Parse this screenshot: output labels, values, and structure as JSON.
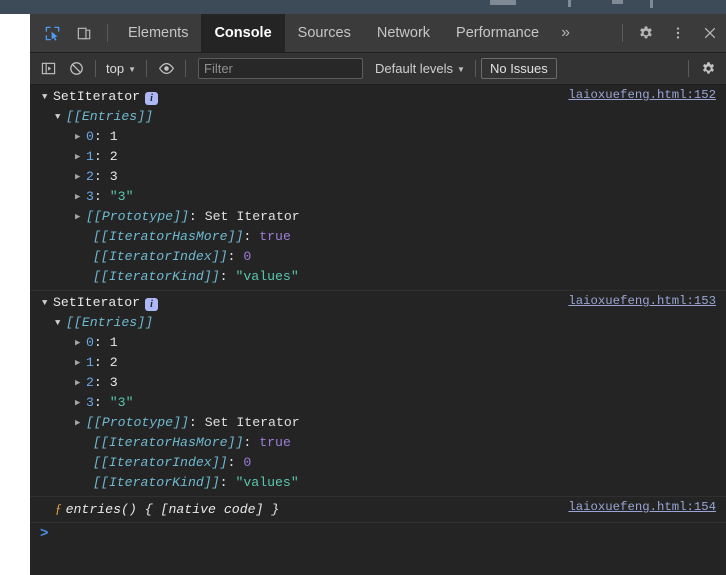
{
  "window": {
    "background_color": "#242424",
    "chrome_strip_color": "#3c4b57"
  },
  "tabbar": {
    "icons": [
      {
        "name": "inspect-element-icon",
        "glyph": "inspect",
        "active": true
      },
      {
        "name": "device-toolbar-icon",
        "glyph": "device",
        "active": false
      }
    ],
    "tabs": [
      {
        "label": "Elements",
        "selected": false
      },
      {
        "label": "Console",
        "selected": true
      },
      {
        "label": "Sources",
        "selected": false
      },
      {
        "label": "Network",
        "selected": false
      },
      {
        "label": "Performance",
        "selected": false
      }
    ],
    "more_tabs_label": "»",
    "settings_label": "gear-icon",
    "menu_label": "kebab-menu-icon",
    "close_label": "✕",
    "accent_color": "#4c9bf0"
  },
  "toolbar": {
    "sidebar_toggle": "show-console-sidebar",
    "clear_console": "clear-console",
    "context": {
      "label": "top",
      "caret": "▼"
    },
    "live_expression": "create-live-expression",
    "filter": {
      "value": "",
      "placeholder": "Filter"
    },
    "levels": {
      "label": "Default levels",
      "caret": "▼"
    },
    "issues": {
      "label": "No Issues"
    },
    "settings": "console-settings"
  },
  "console": {
    "messages": [
      {
        "type": "object",
        "header": "SetIterator",
        "badge": "i",
        "expanded": true,
        "source_link": "laioxuefeng.html:152",
        "entries_label": "[[Entries]]",
        "entries_expanded": true,
        "entries": [
          {
            "key": "0",
            "value": "1",
            "value_kind": "number"
          },
          {
            "key": "1",
            "value": "2",
            "value_kind": "number"
          },
          {
            "key": "2",
            "value": "3",
            "value_kind": "number"
          },
          {
            "key": "3",
            "value": "\"3\"",
            "value_kind": "string"
          }
        ],
        "prototype": {
          "key": "[[Prototype]]",
          "value": "Set Iterator"
        },
        "slots": [
          {
            "key": "[[IteratorHasMore]]",
            "value": "true",
            "value_kind": "boolean"
          },
          {
            "key": "[[IteratorIndex]]",
            "value": "0",
            "value_kind": "number"
          },
          {
            "key": "[[IteratorKind]]",
            "value": "\"values\"",
            "value_kind": "string"
          }
        ]
      },
      {
        "type": "object",
        "header": "SetIterator",
        "badge": "i",
        "expanded": true,
        "source_link": "laioxuefeng.html:153",
        "entries_label": "[[Entries]]",
        "entries_expanded": true,
        "entries": [
          {
            "key": "0",
            "value": "1",
            "value_kind": "number"
          },
          {
            "key": "1",
            "value": "2",
            "value_kind": "number"
          },
          {
            "key": "2",
            "value": "3",
            "value_kind": "number"
          },
          {
            "key": "3",
            "value": "\"3\"",
            "value_kind": "string"
          }
        ],
        "prototype": {
          "key": "[[Prototype]]",
          "value": "Set Iterator"
        },
        "slots": [
          {
            "key": "[[IteratorHasMore]]",
            "value": "true",
            "value_kind": "boolean"
          },
          {
            "key": "[[IteratorIndex]]",
            "value": "0",
            "value_kind": "number"
          },
          {
            "key": "[[IteratorKind]]",
            "value": "\"values\"",
            "value_kind": "string"
          }
        ]
      },
      {
        "type": "function",
        "fn_marker": "ƒ",
        "text": "entries() { [native code] }",
        "source_link": "laioxuefeng.html:154"
      }
    ],
    "prompt_symbol": ">"
  },
  "colors": {
    "string": "#59c7b0",
    "number": "#9d7cd8",
    "boolean": "#9d7cd8",
    "internal_slot": "#6fb9d0",
    "index_key": "#6ba8e8",
    "source_link": "#9aa5d4",
    "function_marker": "#e8a33d",
    "info_badge": "#aeb8f7"
  }
}
